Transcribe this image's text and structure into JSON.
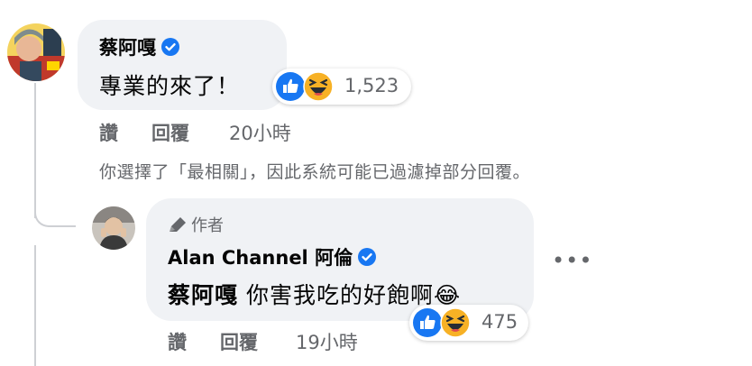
{
  "comment": {
    "author": "蔡阿嘎",
    "text": "專業的來了！",
    "reaction_count": "1,523",
    "reactions": [
      "like-icon",
      "haha-icon"
    ],
    "actions": {
      "like": "讚",
      "reply": "回覆",
      "time": "20小時"
    },
    "filter_note": "你選擇了「最相關」，因此系統可能已過濾掉部分回覆。"
  },
  "reply": {
    "author_badge": "作者",
    "author": "Alan Channel 阿倫",
    "mention": "蔡阿嘎",
    "text": "你害我吃的好飽啊",
    "emoji": "😂",
    "reaction_count": "475",
    "reactions": [
      "like-icon",
      "haha-icon"
    ],
    "actions": {
      "like": "讚",
      "reply": "回覆",
      "time": "19小時"
    },
    "more_label": "•••"
  },
  "colors": {
    "bubble": "#f0f2f5",
    "verified": "#1877f2",
    "like": "#1877f2",
    "haha": "#f7b125",
    "meta": "#65676b"
  }
}
